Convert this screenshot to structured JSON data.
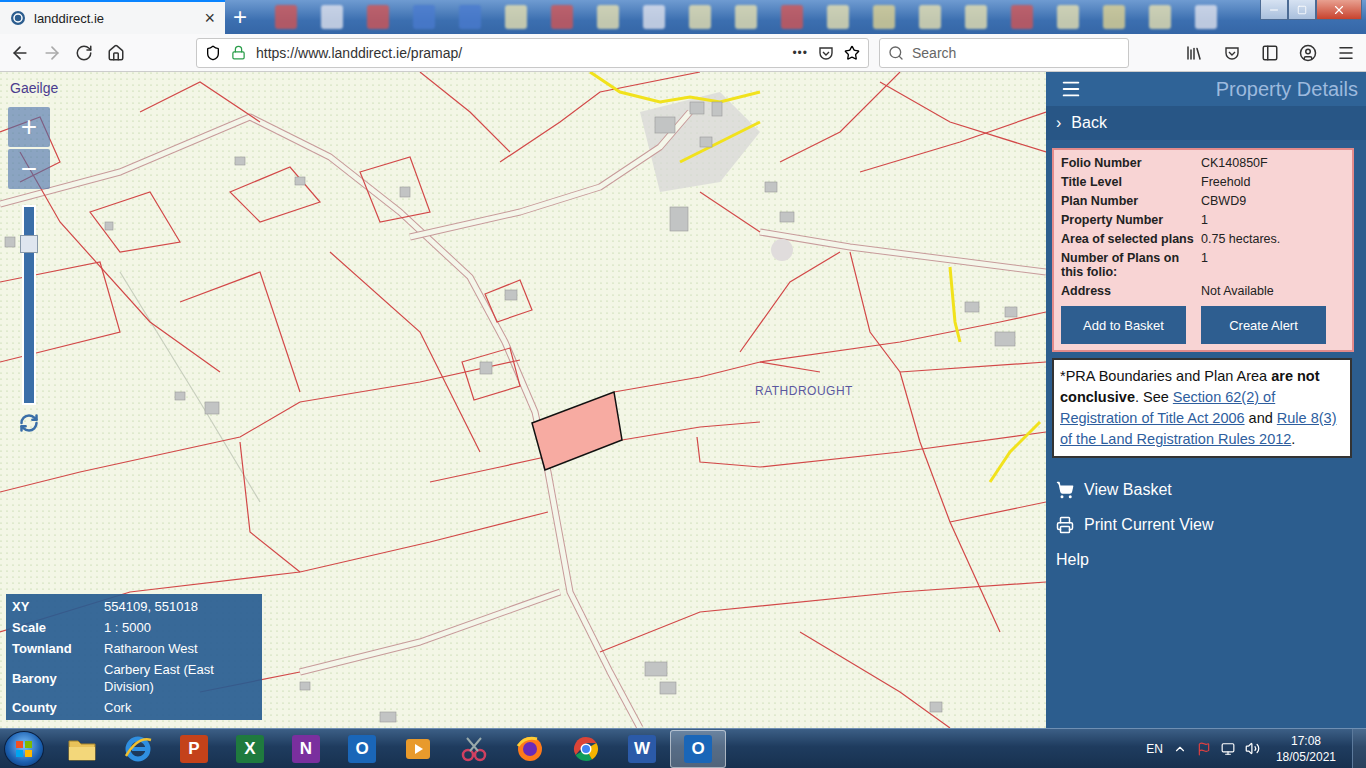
{
  "browser": {
    "tabs": [
      {
        "label": "landdirect.ie",
        "selected": true,
        "close": "×"
      }
    ],
    "new_tab": "+",
    "background_tabs": [
      {
        "color": "#d9534f"
      },
      {
        "color": "#e8e8f0"
      },
      {
        "color": "#d9534f"
      },
      {
        "color": "#4a7bd0"
      },
      {
        "color": "#4a7bd0"
      },
      {
        "color": "#f0e6b0"
      },
      {
        "color": "#d9534f"
      },
      {
        "color": "#f0e6b0"
      },
      {
        "color": "#e8e8f0"
      },
      {
        "color": "#f0e6b0"
      },
      {
        "color": "#f0e6b0"
      },
      {
        "color": "#d9534f"
      },
      {
        "color": "#f0e6b0"
      },
      {
        "color": "#e8d890"
      },
      {
        "color": "#f0e6b0"
      },
      {
        "color": "#f0e6b0"
      },
      {
        "color": "#d9534f"
      },
      {
        "color": "#f0e6b0"
      },
      {
        "color": "#e8d890"
      },
      {
        "color": "#f0e6b0"
      },
      {
        "color": "#e8e8f0"
      }
    ],
    "url": "https://www.landdirect.ie/pramap/",
    "page_actions": "•••",
    "search_placeholder": "Search"
  },
  "map": {
    "language_link": "Gaeilge",
    "zoom_in": "+",
    "zoom_out": "−",
    "zoom_level": 0.84,
    "place_label": "RATHDROUGHT",
    "plot": {
      "selected": true
    },
    "info": [
      {
        "label": "XY",
        "value": "554109, 551018"
      },
      {
        "label": "Scale",
        "value": "1 : 5000"
      },
      {
        "label": "Townland",
        "value": "Ratharoon West"
      },
      {
        "label": "Barony",
        "value": "Carbery East (East Division)"
      },
      {
        "label": "County",
        "value": "Cork"
      }
    ]
  },
  "panel": {
    "title": "Property Details",
    "back": {
      "chevron": "›",
      "label": "Back"
    },
    "details": [
      {
        "label": "Folio Number",
        "value": "CK140850F"
      },
      {
        "label": "Title Level",
        "value": "Freehold"
      },
      {
        "label": "Plan Number",
        "value": "CBWD9"
      },
      {
        "label": "Property Number",
        "value": "1"
      },
      {
        "label": "Area of selected plans",
        "value": "0.75 hectares."
      },
      {
        "label": "Number of Plans on this folio:",
        "value": "1"
      },
      {
        "label": "Address",
        "value": "Not Available"
      }
    ],
    "buttons": [
      "Add to Basket",
      "Create Alert"
    ],
    "notice": [
      {
        "kind": "text",
        "text": "*PRA Boundaries and Plan Area "
      },
      {
        "kind": "bold",
        "text": "are not conclusive"
      },
      {
        "kind": "text",
        "text": ". See "
      },
      {
        "kind": "link",
        "text": "Section 62(2) of Registration of Title Act 2006"
      },
      {
        "kind": "text",
        "text": " and "
      },
      {
        "kind": "link",
        "text": "Rule 8(3) of the Land Registration Rules 2012"
      },
      {
        "kind": "text",
        "text": "."
      }
    ],
    "menu": [
      {
        "kind": "basket",
        "label": "View Basket"
      },
      {
        "kind": "print",
        "label": "Print Current View"
      },
      {
        "kind": "plain",
        "label": "Help"
      }
    ]
  },
  "taskbar": {
    "apps": [
      {
        "kind": "folder",
        "selected": false
      },
      {
        "kind": "ie",
        "selected": false
      },
      {
        "kind": "office",
        "glyph": "P",
        "color": "#c4421a",
        "selected": false
      },
      {
        "kind": "office",
        "glyph": "X",
        "color": "#1f7a3e",
        "selected": false
      },
      {
        "kind": "office",
        "glyph": "N",
        "color": "#7a2f9e",
        "selected": false
      },
      {
        "kind": "office",
        "glyph": "O",
        "color": "#1a66b8",
        "selected": false
      },
      {
        "kind": "media",
        "selected": false
      },
      {
        "kind": "snip",
        "selected": false
      },
      {
        "kind": "firefox",
        "selected": false
      },
      {
        "kind": "chrome",
        "selected": false
      },
      {
        "kind": "office",
        "glyph": "W",
        "color": "#2b5aa8",
        "selected": false
      },
      {
        "kind": "office",
        "glyph": "O",
        "color": "#1a66b8",
        "selected": true
      }
    ],
    "language": "EN",
    "time": "17:08",
    "date": "18/05/2021"
  }
}
